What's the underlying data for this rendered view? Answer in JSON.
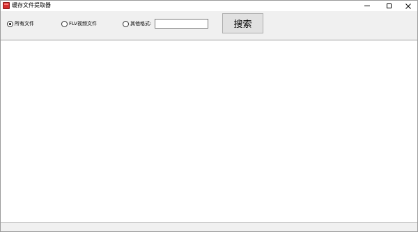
{
  "window": {
    "title": "缓存文件提取器"
  },
  "controls": {
    "window_buttons": [
      "minimize-icon",
      "maximize-icon",
      "close-icon"
    ]
  },
  "filters": {
    "options": [
      {
        "label": "所有文件",
        "checked": true
      },
      {
        "label": "FLV视频文件",
        "checked": false
      },
      {
        "label": "其他格式:",
        "checked": false
      }
    ],
    "extension_value": ""
  },
  "search": {
    "button_label": "搜索"
  },
  "results": {
    "items": []
  },
  "colors": {
    "app_icon": "#d32f2f",
    "window_bg": "#f0f0f0",
    "button_bg": "#e1e1e1"
  }
}
